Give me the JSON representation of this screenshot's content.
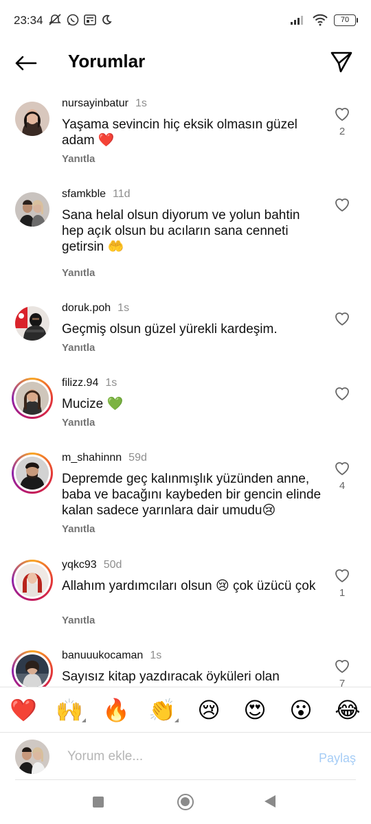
{
  "status_bar": {
    "time": "23:34",
    "battery": "70"
  },
  "header": {
    "title": "Yorumlar"
  },
  "comments": [
    {
      "username": "nursayinbatur",
      "time": "1s",
      "text": "Yaşama sevincin hiç eksik olmasın güzel adam ❤️",
      "reply": "Yanıtla",
      "likes": "2",
      "ring": false
    },
    {
      "username": "sfamkble",
      "time": "11d",
      "text": "Sana helal olsun diyorum ve yolun bahtin hep açık olsun bu acıların sana cenneti getirsin 🤲",
      "reply": "Yanıtla",
      "likes": "",
      "ring": false
    },
    {
      "username": "doruk.poh",
      "time": "1s",
      "text": "Geçmiş olsun güzel yürekli kardeşim.",
      "reply": "Yanıtla",
      "likes": "",
      "ring": false
    },
    {
      "username": "filizz.94",
      "time": "1s",
      "text": "Mucize 💚",
      "reply": "Yanıtla",
      "likes": "",
      "ring": true
    },
    {
      "username": "m_shahinnn",
      "time": "59d",
      "text": "Depremde geç kalınmışlık yüzünden anne, baba ve bacağını kaybeden bir gencin elinde kalan sadece yarınlara dair umudu😢",
      "reply": "Yanıtla",
      "likes": "4",
      "ring": true
    },
    {
      "username": "yqkc93",
      "time": "50d",
      "text": "Allahım yardımcıları olsun 😢 çok üzücü çok",
      "reply": "Yanıtla",
      "likes": "1",
      "ring": true
    },
    {
      "username": "banuuukocaman",
      "time": "1s",
      "text": "Sayısız kitap yazdıracak öyküleri olan",
      "reply": "",
      "likes": "7",
      "ring": true
    }
  ],
  "emoji_bar": [
    "❤️",
    "🙌",
    "🔥",
    "👏",
    "😢",
    "😍",
    "😮",
    "😂"
  ],
  "input": {
    "placeholder": "Yorum ekle...",
    "share_label": "Paylaş"
  }
}
